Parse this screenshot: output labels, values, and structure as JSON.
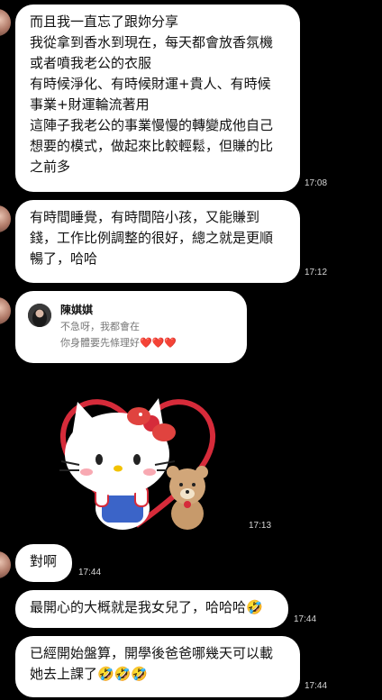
{
  "messages": [
    {
      "lines": [
        "而且我一直忘了跟妳分享",
        "我從拿到香水到現在，每天都會放香氛機",
        "或者噴我老公的衣服",
        "有時候淨化、有時候財運+貴人、有時候",
        "事業+財運輪流著用",
        "這陣子我老公的事業慢慢的轉變成他自己",
        "想要的模式，做起來比較輕鬆，但賺的比",
        "之前多"
      ],
      "time": "17:08"
    },
    {
      "lines": [
        "有時間睡覺，有時間陪小孩，又能賺到",
        "錢，工作比例調整的很好，總之就是更順",
        "暢了，哈哈"
      ],
      "time": "17:12"
    },
    {
      "time": "17:13"
    },
    {
      "lines": [
        "對啊"
      ],
      "time": "17:44"
    },
    {
      "lines": [
        "最開心的大概就是我女兒了，哈哈哈🤣"
      ],
      "time": "17:44"
    },
    {
      "lines": [
        "已經開始盤算，開學後爸爸哪幾天可以載",
        "她去上課了🤣🤣🤣"
      ],
      "time": "17:44"
    }
  ],
  "reply_card": {
    "name": "陳娸娸",
    "lines": [
      "不急呀，我都會在",
      "你身體要先條理好❤️❤️❤️"
    ]
  },
  "colors": {
    "background": "#000000",
    "bubble": "#ffffff",
    "time": "#d7d7d7",
    "heart": "#e0282e"
  },
  "icons": {
    "sticker": "hello-kitty-with-bear-heart-sticker",
    "avatar": "contact-avatar"
  }
}
